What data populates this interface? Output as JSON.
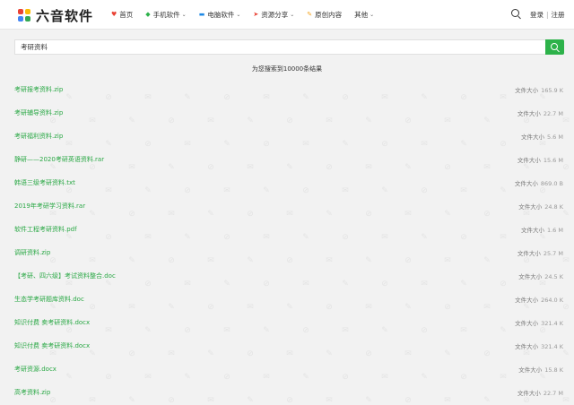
{
  "site": {
    "name": "六音软件"
  },
  "nav": [
    {
      "icon": "home-icon",
      "glyph": "♥",
      "color": "#e94235",
      "label": "首页",
      "has_dropdown": false
    },
    {
      "icon": "phone-app-icon",
      "glyph": "◆",
      "color": "#2db24a",
      "label": "手机软件",
      "has_dropdown": true
    },
    {
      "icon": "monitor-icon",
      "glyph": "▬",
      "color": "#1e88e5",
      "label": "电脑软件",
      "has_dropdown": true
    },
    {
      "icon": "share-icon",
      "glyph": "➤",
      "color": "#e94235",
      "label": "资源分享",
      "has_dropdown": true
    },
    {
      "icon": "pen-icon",
      "glyph": "✎",
      "color": "#f5a623",
      "label": "原创内容",
      "has_dropdown": false
    },
    {
      "icon": "more-icon",
      "glyph": "",
      "color": "#333333",
      "label": "其他",
      "has_dropdown": true
    }
  ],
  "auth": {
    "login": "登录",
    "register": "注册"
  },
  "search": {
    "value": "考研资料"
  },
  "result_count_text": "为您搜索到10000条结果",
  "size_label": "文件大小",
  "colors": {
    "accent": "#2db24a",
    "link": "#2aa845"
  },
  "results": [
    {
      "name": "考研报考资料.zip",
      "size": "165.9 K"
    },
    {
      "name": "考研辅导资料.zip",
      "size": "22.7 M"
    },
    {
      "name": "考研福利资料.zip",
      "size": "5.6 M"
    },
    {
      "name": "静研——2020考研英语资料.rar",
      "size": "15.6 M"
    },
    {
      "name": "韩语三级考研资料.txt",
      "size": "869.0 B"
    },
    {
      "name": "2019年考研学习资料.rar",
      "size": "24.8 K"
    },
    {
      "name": "软件工程考研资料.pdf",
      "size": "1.6 M"
    },
    {
      "name": "调研资料.zip",
      "size": "25.7 M"
    },
    {
      "name": "【考研、四六级】考试资料整合.doc",
      "size": "24.5 K"
    },
    {
      "name": "生态学考研题库资料.doc",
      "size": "264.0 K"
    },
    {
      "name": "知识付费 卖考研资料.docx",
      "size": "321.4 K"
    },
    {
      "name": "知识付费 卖考研资料.docx",
      "size": "321.4 K"
    },
    {
      "name": "考研资源.docx",
      "size": "15.8 K"
    },
    {
      "name": "高考资料.zip",
      "size": "22.7 M"
    }
  ]
}
